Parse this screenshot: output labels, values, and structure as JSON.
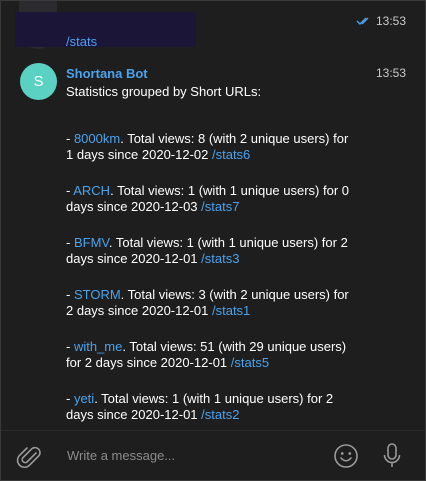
{
  "previous_message": {
    "link": "/stats",
    "time": "13:53"
  },
  "bot_message": {
    "avatar_letter": "S",
    "sender": "Shortana Bot",
    "time": "13:53",
    "heading": "Statistics grouped by Short URLs:",
    "entries": [
      {
        "prefix": "- ",
        "name": "8000km",
        "text": ". Total views: 8 (with 2 unique users) for 1 days since 2020-12-02 ",
        "stats": "/stats6"
      },
      {
        "prefix": "- ",
        "name": "ARCH",
        "text": ". Total views: 1 (with 1 unique users) for 0 days since 2020-12-03 ",
        "stats": "/stats7"
      },
      {
        "prefix": "- ",
        "name": "BFMV",
        "text": ". Total views: 1 (with 1 unique users) for 2 days since 2020-12-01 ",
        "stats": "/stats3"
      },
      {
        "prefix": "- ",
        "name": "STORM",
        "text": ". Total views: 3 (with 2 unique users) for 2 days since 2020-12-01 ",
        "stats": "/stats1"
      },
      {
        "prefix": "- ",
        "name": "with_me",
        "text": ". Total views: 51 (with 29 unique users) for 2 days since 2020-12-01 ",
        "stats": "/stats5"
      },
      {
        "prefix": "- ",
        "name": "yeti",
        "text": ". Total views: 1 (with 1 unique users) for 2 days since 2020-12-01 ",
        "stats": "/stats2"
      }
    ]
  },
  "composer": {
    "placeholder": "Write a message...",
    "icons": {
      "attach": "paperclip-icon",
      "emoji": "smiley-icon",
      "voice": "microphone-icon",
      "read": "double-check-icon"
    }
  },
  "colors": {
    "background": "#1e1e1e",
    "link": "#4aa3ee",
    "avatar": "#5ad1c2",
    "text": "#ffffff",
    "muted": "#8c8c8c"
  }
}
